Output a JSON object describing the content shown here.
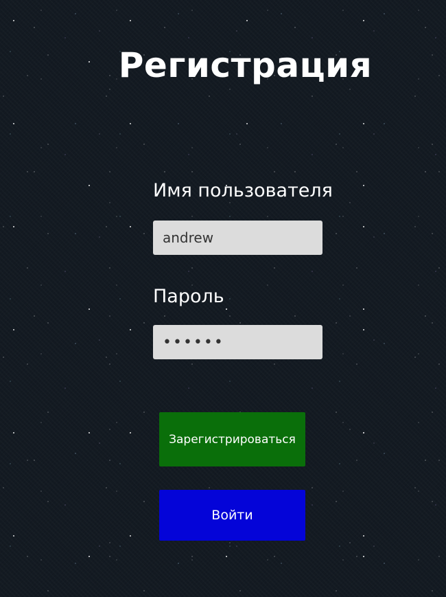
{
  "page": {
    "title": "Регистрация"
  },
  "form": {
    "username_label": "Имя пользователя",
    "username_value": "andrew",
    "password_label": "Пароль",
    "password_value": "andrew"
  },
  "buttons": {
    "register_label": "Зарегистрироваться",
    "login_label": "Войти"
  },
  "colors": {
    "background": "#131a22",
    "input_background": "#dcdcdc",
    "register_button": "#0a6f0a",
    "login_button": "#0404d8",
    "text": "#ffffff"
  }
}
